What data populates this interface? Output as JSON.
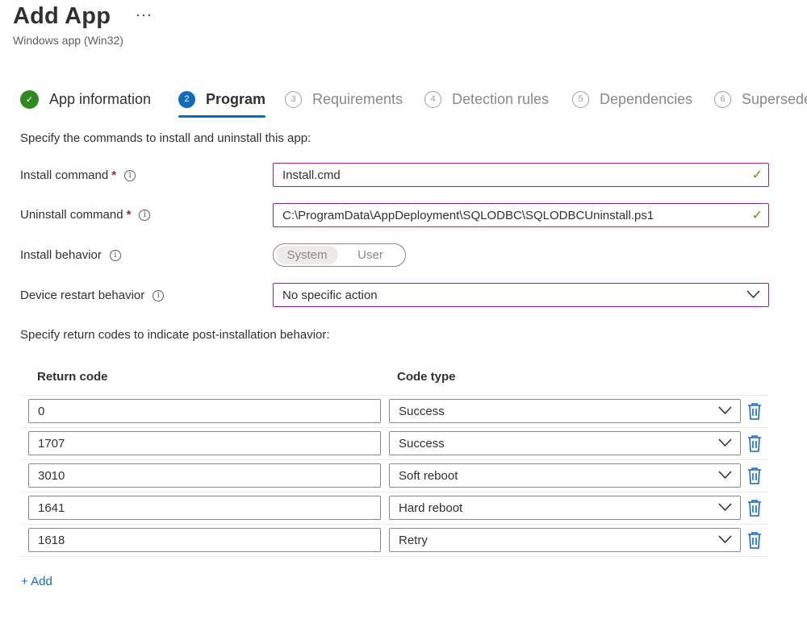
{
  "header": {
    "title": "Add App",
    "more": "···",
    "subtitle": "Windows app (Win32)"
  },
  "steps": [
    {
      "number": "✓",
      "label": "App information",
      "state": "done"
    },
    {
      "number": "2",
      "label": "Program",
      "state": "active"
    },
    {
      "number": "3",
      "label": "Requirements",
      "state": "todo"
    },
    {
      "number": "4",
      "label": "Detection rules",
      "state": "todo"
    },
    {
      "number": "5",
      "label": "Dependencies",
      "state": "todo"
    },
    {
      "number": "6",
      "label": "Supersedence",
      "state": "todo"
    }
  ],
  "form": {
    "intro": "Specify the commands to install and uninstall this app:",
    "install_command": {
      "label": "Install command",
      "required": "*",
      "value": "Install.cmd"
    },
    "uninstall_command": {
      "label": "Uninstall command",
      "required": "*",
      "value": "C:\\ProgramData\\AppDeployment\\SQLODBC\\SQLODBCUninstall.ps1"
    },
    "install_behavior": {
      "label": "Install behavior",
      "options": [
        "System",
        "User"
      ],
      "selected": "System"
    },
    "device_restart": {
      "label": "Device restart behavior",
      "value": "No specific action"
    },
    "info_glyph": "i"
  },
  "return_codes": {
    "intro": "Specify return codes to indicate post-installation behavior:",
    "headers": {
      "code": "Return code",
      "type": "Code type"
    },
    "rows": [
      {
        "code": "0",
        "type": "Success"
      },
      {
        "code": "1707",
        "type": "Success"
      },
      {
        "code": "3010",
        "type": "Soft reboot"
      },
      {
        "code": "1641",
        "type": "Hard reboot"
      },
      {
        "code": "1618",
        "type": "Retry"
      }
    ],
    "add_label": "+ Add"
  },
  "colors": {
    "accent": "#0f6cbd",
    "success": "#2e8b1f",
    "valid_border": "#8a2b8a",
    "required": "#a4262c"
  }
}
